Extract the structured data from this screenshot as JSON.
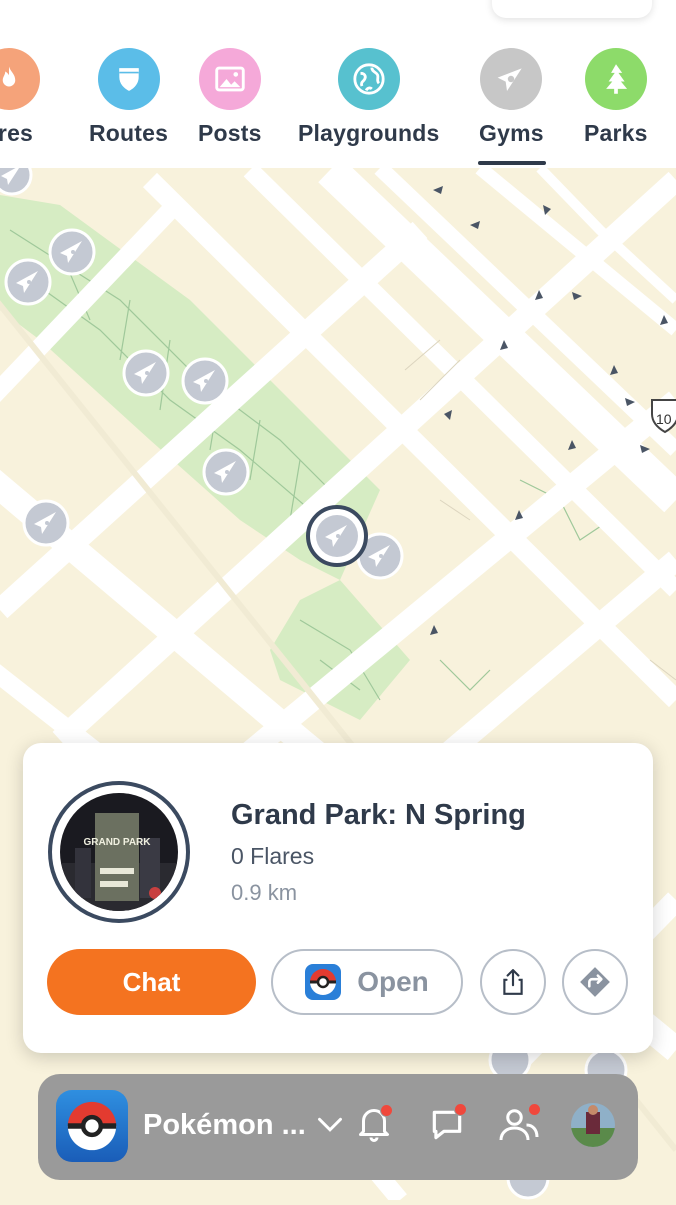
{
  "categories": [
    {
      "label": "ares",
      "icon": "flame-icon",
      "color": "#f5a37a"
    },
    {
      "label": "Routes",
      "icon": "route-shield-icon",
      "color": "#5bbde8"
    },
    {
      "label": "Posts",
      "icon": "image-icon",
      "color": "#f5a9d9"
    },
    {
      "label": "Playgrounds",
      "icon": "globe-icon",
      "color": "#57c1cf"
    },
    {
      "label": "Gyms",
      "icon": "gym-pin-icon",
      "color": "#c7c7c7"
    },
    {
      "label": "Parks",
      "icon": "tree-icon",
      "color": "#8ddb6a"
    }
  ],
  "selected_category": "Gyms",
  "map": {
    "route_marker": "10"
  },
  "place": {
    "title": "Grand Park: N Spring",
    "flares": "0 Flares",
    "distance": "0.9 km",
    "photo_text": "GRAND PARK"
  },
  "actions": {
    "chat_label": "Chat",
    "open_label": "Open"
  },
  "bottom_bar": {
    "app_name": "Pokémon ...",
    "accent": "#f47320"
  }
}
